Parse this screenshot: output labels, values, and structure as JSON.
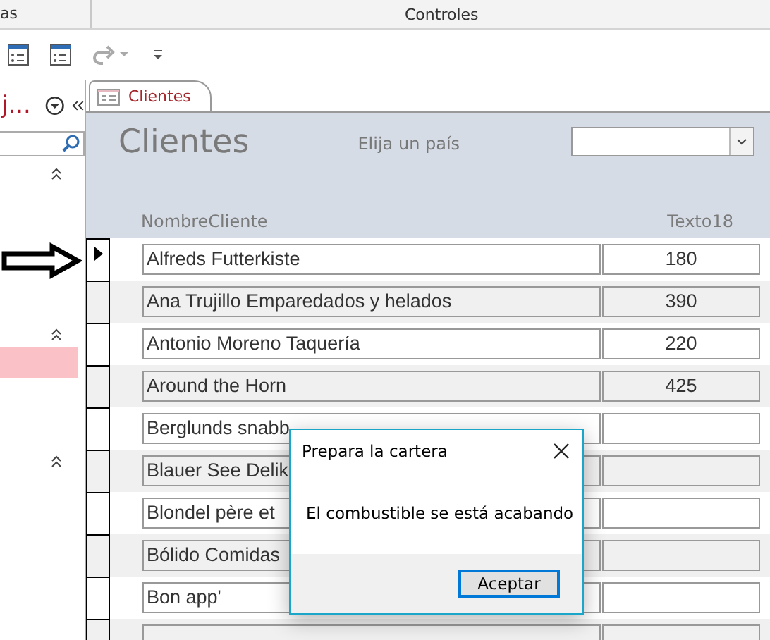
{
  "ribbon": {
    "groups": [
      "as",
      "Controles"
    ]
  },
  "nav_pane": {
    "title": "j..."
  },
  "tab": {
    "label": "Clientes",
    "selected": true
  },
  "form": {
    "title": "Clientes",
    "filter_label": "Elija un país",
    "columns": [
      "NombreCliente",
      "Texto18"
    ],
    "rows": [
      {
        "name": "Alfreds Futterkiste",
        "value": "180",
        "current": true
      },
      {
        "name": "Ana Trujillo Emparedados y helados",
        "value": "390",
        "current": false
      },
      {
        "name": "Antonio Moreno Taquería",
        "value": "220",
        "current": false
      },
      {
        "name": "Around the Horn",
        "value": "425",
        "current": false
      },
      {
        "name": "Berglunds snabb",
        "current": false
      },
      {
        "name": "Blauer See Delik",
        "current": false
      },
      {
        "name": "Blondel père et",
        "current": false
      },
      {
        "name": "Bólido Comidas",
        "current": false
      },
      {
        "name": "Bon app'",
        "current": false
      },
      {
        "current": false
      }
    ]
  },
  "dialog": {
    "title": "Prepara la cartera",
    "message": "El combustible se está acabando",
    "button": "Aceptar"
  }
}
